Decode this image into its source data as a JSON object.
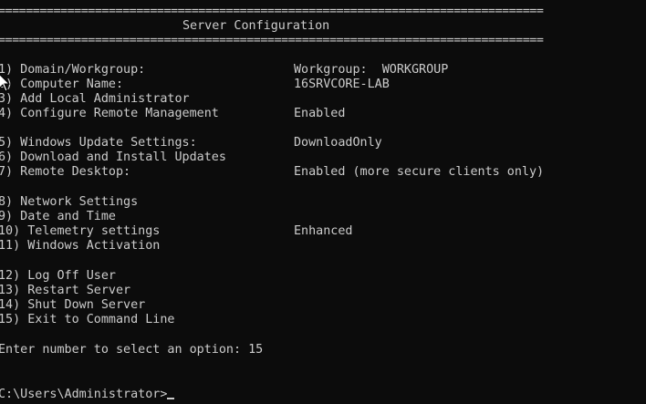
{
  "window": {
    "title": "Server Configuration",
    "separator": "==============================================================================="
  },
  "menu": [
    {
      "label": "1) Domain/Workgroup:",
      "value": "Workgroup:  WORKGROUP"
    },
    {
      "label": "2) Computer Name:",
      "value": "16SRVCORE-LAB"
    },
    {
      "label": "3) Add Local Administrator",
      "value": ""
    },
    {
      "label": "4) Configure Remote Management",
      "value": "Enabled"
    },
    {
      "label": "5) Windows Update Settings:",
      "value": "DownloadOnly"
    },
    {
      "label": "6) Download and Install Updates",
      "value": ""
    },
    {
      "label": "7) Remote Desktop:",
      "value": "Enabled (more secure clients only)"
    },
    {
      "label": "8) Network Settings",
      "value": ""
    },
    {
      "label": "9) Date and Time",
      "value": ""
    },
    {
      "label": "10) Telemetry settings",
      "value": "Enhanced"
    },
    {
      "label": "11) Windows Activation",
      "value": ""
    },
    {
      "label": "12) Log Off User",
      "value": ""
    },
    {
      "label": "13) Restart Server",
      "value": ""
    },
    {
      "label": "14) Shut Down Server",
      "value": ""
    },
    {
      "label": "15) Exit to Command Line",
      "value": ""
    }
  ],
  "prompt": {
    "text": "Enter number to select an option: 15"
  },
  "shell": {
    "prompt": "C:\\Users\\Administrator>"
  },
  "theme": {
    "background": "#0c0c0c",
    "foreground": "#cccccc"
  }
}
